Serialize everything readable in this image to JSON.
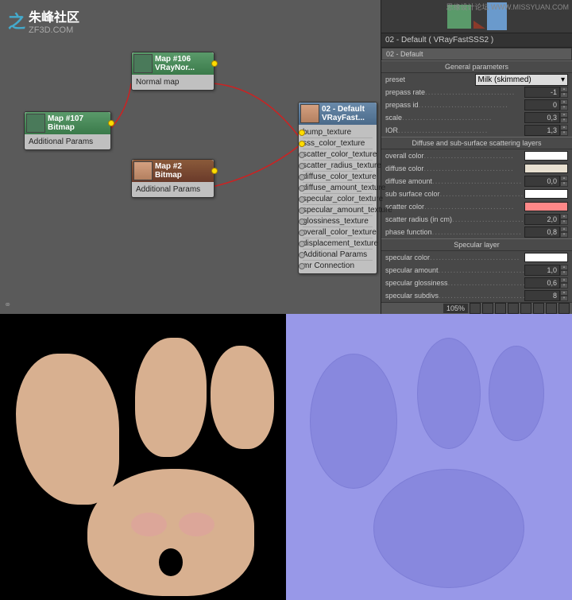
{
  "watermark": "思缘设计论坛  WWW.MISSYUAN.COM",
  "logo": {
    "main": "朱峰社区",
    "sub": "ZF3D.COM"
  },
  "nodes": {
    "bitmap": {
      "line1": "Map #107",
      "line2": "Bitmap",
      "params": "Additional Params"
    },
    "normal": {
      "line1": "Map #106",
      "line2": "VRayNor...",
      "row": "Normal map"
    },
    "bitmap2": {
      "line1": "Map #2",
      "line2": "Bitmap",
      "params": "Additional Params"
    },
    "material": {
      "line1": "02 - Default",
      "line2": "VRayFast...",
      "rows": [
        "bump_texture",
        "sss_color_texture",
        "scatter_color_texture",
        "scatter_radius_texture",
        "diffuse_color_texture",
        "diffuse_amount_texture",
        "specular_color_texture",
        "specular_amount_texture",
        "glossiness_texture",
        "overall_color_texture",
        "displacement_texture",
        "Additional Params",
        "mr Connection"
      ]
    }
  },
  "panel": {
    "title": "02 - Default  ( VRayFastSSS2 )",
    "subtitle": "02 - Default",
    "sections": {
      "general": {
        "title": "General parameters",
        "preset_label": "preset",
        "preset_value": "Milk (skimmed)",
        "params": [
          {
            "label": "prepass rate",
            "value": "-1"
          },
          {
            "label": "prepass id",
            "value": "0"
          },
          {
            "label": "scale",
            "value": "0,3"
          },
          {
            "label": "IOR",
            "value": "1,3"
          }
        ]
      },
      "diffuse": {
        "title": "Diffuse and sub-surface scattering layers",
        "swatches": [
          {
            "label": "overall color",
            "color": "#ffffff"
          },
          {
            "label": "diffuse color",
            "color": "#e8e0d0"
          }
        ],
        "amount": {
          "label": "diffuse amount",
          "value": "0,0"
        },
        "swatches2": [
          {
            "label": "sub surface color",
            "color": "#ffffff"
          },
          {
            "label": "scatter color",
            "color": "#ff8888"
          }
        ],
        "params2": [
          {
            "label": "scatter radius (in cm)",
            "value": "2,0"
          },
          {
            "label": "phase function",
            "value": "0,8"
          }
        ]
      },
      "specular": {
        "title": "Specular layer",
        "swatch": {
          "label": "specular color",
          "color": "#ffffff"
        },
        "params": [
          {
            "label": "specular amount",
            "value": "1,0"
          },
          {
            "label": "specular glossiness",
            "value": "0,6"
          },
          {
            "label": "specular subdivs",
            "value": "8"
          }
        ]
      }
    }
  },
  "zoom": "105%"
}
